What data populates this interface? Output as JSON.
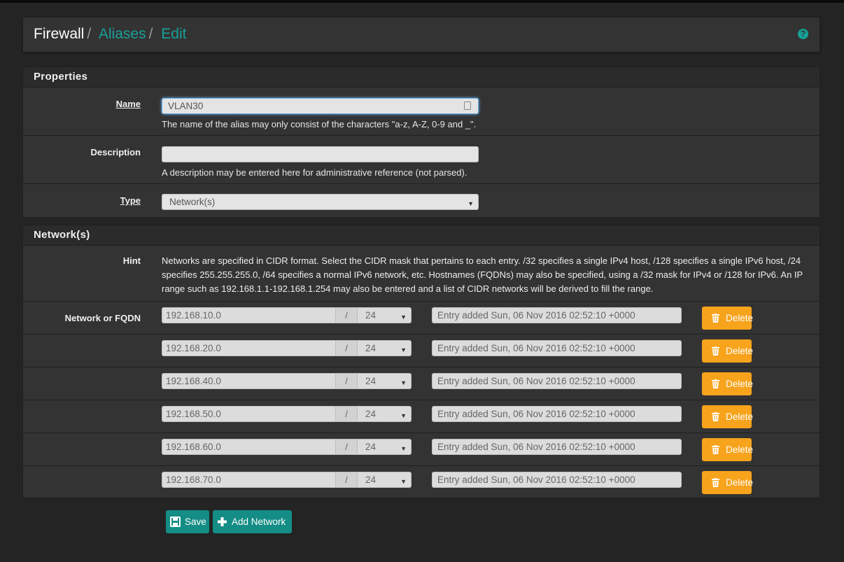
{
  "breadcrumb": {
    "root": "Firewall",
    "section": "Aliases",
    "page": "Edit",
    "separator": "/"
  },
  "help_icon": "question-circle-icon",
  "properties": {
    "heading": "Properties",
    "name": {
      "label": "Name",
      "value": "VLAN30",
      "help": "The name of the alias may only consist of the characters \"a-z, A-Z, 0-9 and _\"."
    },
    "description": {
      "label": "Description",
      "value": "",
      "help": "A description may be entered here for administrative reference (not parsed)."
    },
    "type": {
      "label": "Type",
      "value": "Network(s)"
    }
  },
  "networks": {
    "heading": "Network(s)",
    "hint_label": "Hint",
    "hint": "Networks are specified in CIDR format. Select the CIDR mask that pertains to each entry. /32 specifies a single IPv4 host, /128 specifies a single IPv6 host, /24 specifies 255.255.255.0, /64 specifies a normal IPv6 network, etc. Hostnames (FQDNs) may also be specified, using a /32 mask for IPv4 or /128 for IPv6. An IP range such as 192.168.1.1-192.168.1.254 may also be entered and a list of CIDR networks will be derived to fill the range.",
    "row_label": "Network or FQDN",
    "slash": "/",
    "delete_label": "Delete",
    "entries": [
      {
        "address": "192.168.10.0",
        "cidr": "24",
        "description": "Entry added Sun, 06 Nov 2016 02:52:10 +0000"
      },
      {
        "address": "192.168.20.0",
        "cidr": "24",
        "description": "Entry added Sun, 06 Nov 2016 02:52:10 +0000"
      },
      {
        "address": "192.168.40.0",
        "cidr": "24",
        "description": "Entry added Sun, 06 Nov 2016 02:52:10 +0000"
      },
      {
        "address": "192.168.50.0",
        "cidr": "24",
        "description": "Entry added Sun, 06 Nov 2016 02:52:10 +0000"
      },
      {
        "address": "192.168.60.0",
        "cidr": "24",
        "description": "Entry added Sun, 06 Nov 2016 02:52:10 +0000"
      },
      {
        "address": "192.168.70.0",
        "cidr": "24",
        "description": "Entry added Sun, 06 Nov 2016 02:52:10 +0000"
      }
    ]
  },
  "actions": {
    "save": "Save",
    "add_network": "Add Network"
  },
  "colors": {
    "accent": "#17a198",
    "button": "#138d85",
    "delete": "#f7a31c"
  }
}
